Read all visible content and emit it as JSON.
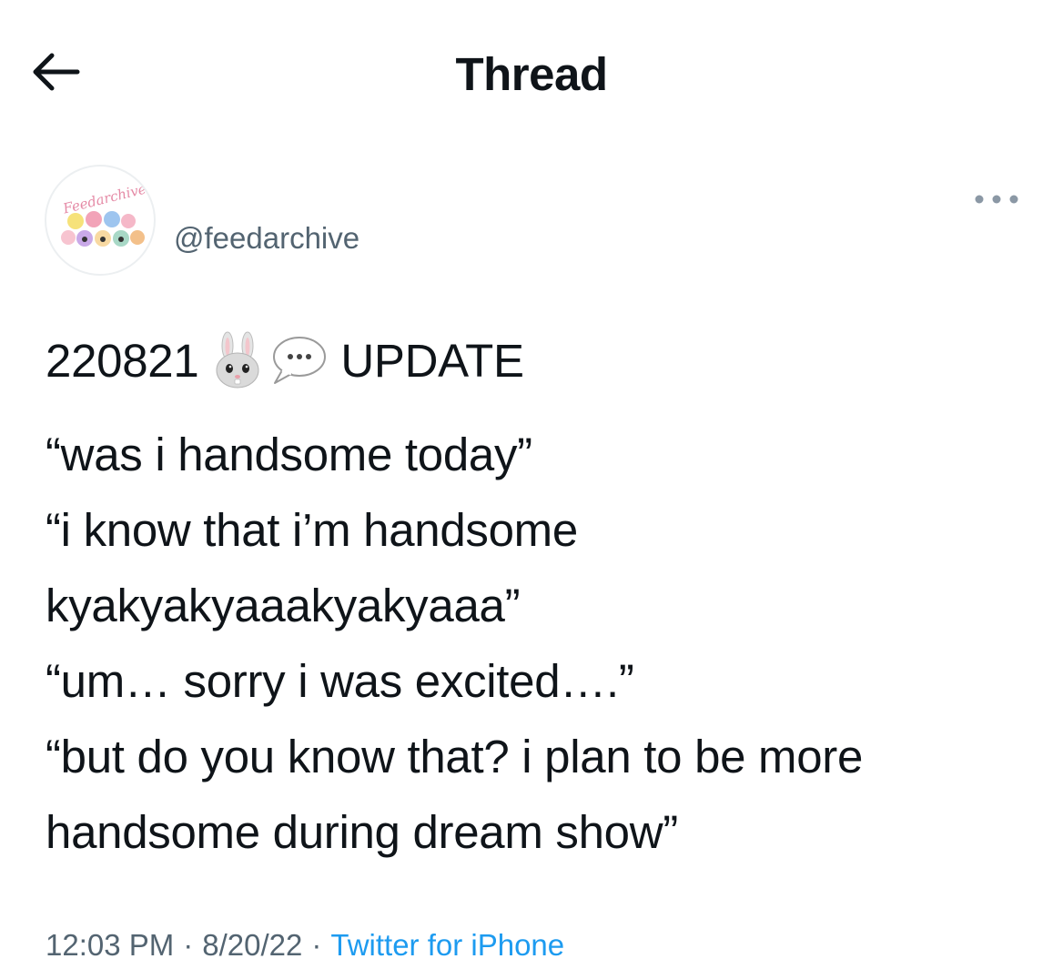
{
  "header": {
    "title": "Thread",
    "back_icon": "arrow-left-icon"
  },
  "author": {
    "handle": "@feedarchive",
    "avatar_logo_text": "Feedarchive",
    "more_icon": "more-horizontal-icon"
  },
  "tweet": {
    "first_line": {
      "date": "220821",
      "emojis": [
        "rabbit-face-emoji",
        "speech-bubble-emoji"
      ],
      "label": "UPDATE"
    },
    "lines": [
      "“was i handsome today”",
      "“i know that i’m handsome",
      "kyakyakyaaakyakyaaa”",
      "“um… sorry i was excited….”",
      "“but do you know that? i plan to be more",
      "handsome during dream show”"
    ]
  },
  "meta": {
    "time": "12:03 PM",
    "separator": "·",
    "date": "8/20/22",
    "source": "Twitter for iPhone"
  },
  "colors": {
    "text": "#0f1419",
    "secondary": "#536471",
    "link": "#1d9bf0",
    "background": "#ffffff"
  }
}
